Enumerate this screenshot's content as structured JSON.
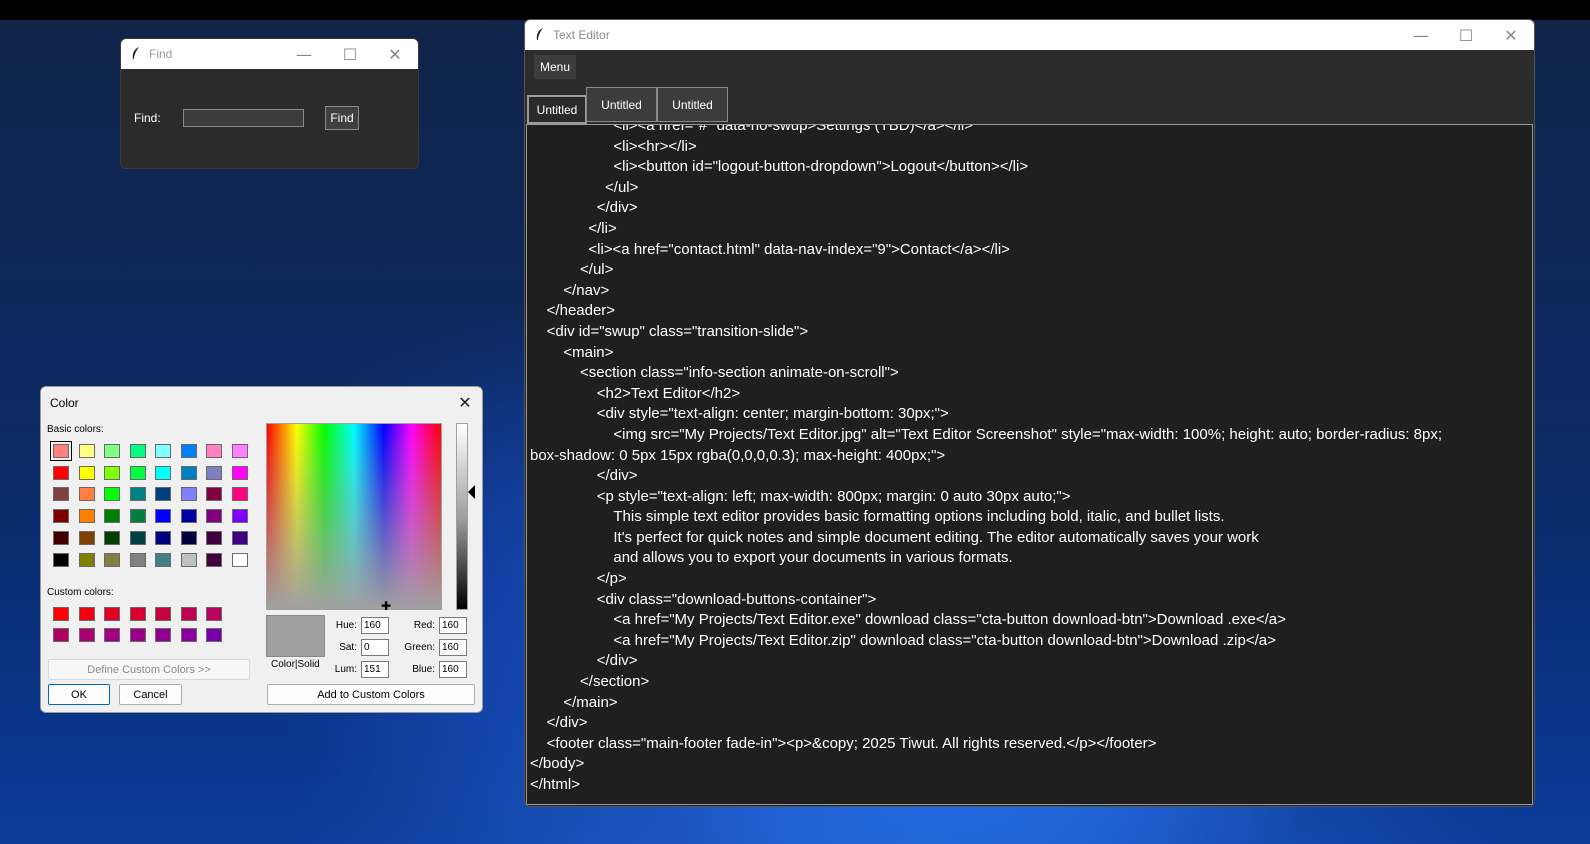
{
  "find_window": {
    "title": "Find",
    "find_label": "Find:",
    "find_input_value": "",
    "find_button": "Find"
  },
  "color_dialog": {
    "title": "Color",
    "basic_colors_label": "Basic colors:",
    "custom_colors_label": "Custom colors:",
    "basic_colors": [
      "#ff8080",
      "#ffff80",
      "#80ff80",
      "#00ff80",
      "#80ffff",
      "#0080ff",
      "#ff80c0",
      "#ff80ff",
      "#ff0000",
      "#ffff00",
      "#80ff00",
      "#00ff40",
      "#00ffff",
      "#0080c0",
      "#8080c0",
      "#ff00ff",
      "#804040",
      "#ff8040",
      "#00ff00",
      "#008080",
      "#004080",
      "#8080ff",
      "#800040",
      "#ff0080",
      "#800000",
      "#ff8000",
      "#008000",
      "#008040",
      "#0000ff",
      "#0000a0",
      "#800080",
      "#8000ff",
      "#400000",
      "#804000",
      "#004000",
      "#004040",
      "#000080",
      "#000040",
      "#400040",
      "#400080",
      "#000000",
      "#808000",
      "#808040",
      "#808080",
      "#408080",
      "#c0c0c0",
      "#400040",
      "#ffffff"
    ],
    "custom_colors": [
      "#ff0000",
      "#f00010",
      "#e00020",
      "#d80030",
      "#c80040",
      "#c00050",
      "#b80060",
      "#b00060",
      "#a80070",
      "#a00080",
      "#980088",
      "#900090",
      "#8800a0",
      "#7800a8"
    ],
    "define_custom_button": "Define Custom Colors >>",
    "ok_button": "OK",
    "cancel_button": "Cancel",
    "color_solid_label": "Color|Solid",
    "hue_label": "Hue:",
    "hue_value": "160",
    "sat_label": "Sat:",
    "sat_value": "0",
    "lum_label": "Lum:",
    "lum_value": "151",
    "red_label": "Red:",
    "red_value": "160",
    "green_label": "Green:",
    "green_value": "160",
    "blue_label": "Blue:",
    "blue_value": "160",
    "add_custom_button": "Add to Custom Colors",
    "preview_color": "#a0a0a0"
  },
  "editor": {
    "title": "Text Editor",
    "menu_button": "Menu",
    "tabs": [
      "Untitled",
      "Untitled",
      "Untitled"
    ],
    "code": "                    <li><a href=\"#\" data-no-swup>Settings (TBD)</a></li>\n                    <li><hr></li>\n                    <li><button id=\"logout-button-dropdown\">Logout</button></li>\n                  </ul>\n                </div>\n              </li>\n              <li><a href=\"contact.html\" data-nav-index=\"9\">Contact</a></li>\n            </ul>\n        </nav>\n    </header>\n    <div id=\"swup\" class=\"transition-slide\">\n        <main>\n            <section class=\"info-section animate-on-scroll\">\n                <h2>Text Editor</h2>\n                <div style=\"text-align: center; margin-bottom: 30px;\">\n                    <img src=\"My Projects/Text Editor.jpg\" alt=\"Text Editor Screenshot\" style=\"max-width: 100%; height: auto; border-radius: 8px;\nbox-shadow: 0 5px 15px rgba(0,0,0,0.3); max-height: 400px;\">\n                </div>\n                <p style=\"text-align: left; max-width: 800px; margin: 0 auto 30px auto;\">\n                    This simple text editor provides basic formatting options including bold, italic, and bullet lists.\n                    It's perfect for quick notes and simple document editing. The editor automatically saves your work\n                    and allows you to export your documents in various formats.\n                </p>\n                <div class=\"download-buttons-container\">\n                    <a href=\"My Projects/Text Editor.exe\" download class=\"cta-button download-btn\">Download .exe</a>\n                    <a href=\"My Projects/Text Editor.zip\" download class=\"cta-button download-btn\">Download .zip</a>\n                </div>\n            </section>\n        </main>\n    </div>\n    <footer class=\"main-footer fade-in\"><p>&copy; 2025 Tiwut. All rights reserved.</p></footer>\n</body>\n</html>"
  }
}
